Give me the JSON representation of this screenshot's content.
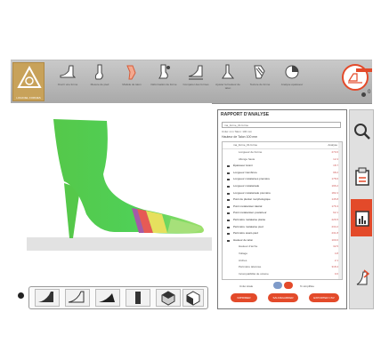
{
  "toolbar": {
    "logo_text": "LOGICIEL FORMES",
    "buttons": [
      {
        "label": "Ouvrir une forme",
        "icon": "shoe-icon"
      },
      {
        "label": "Mesure de pied",
        "icon": "foot-icon"
      },
      {
        "label": "Modèle de talon",
        "icon": "heel-icon"
      },
      {
        "label": "Déformation de forme",
        "icon": "deform-icon"
      },
      {
        "label": "Comparer des formes",
        "icon": "compare-icon"
      },
      {
        "label": "Ajuster la hauteur de talon",
        "icon": "heel-height-icon"
      },
      {
        "label": "Texture de forme",
        "icon": "texture-icon"
      },
      {
        "label": "Analyse épaisseur",
        "icon": "thickness-icon"
      }
    ],
    "status_small": "0"
  },
  "panel": {
    "title": "RAPPORT D'ANALYSE",
    "select_value": "ma_forme_01.forme",
    "subtitle": "Unité: mm   Talon: 100 mm",
    "note": "Hauteur de Talon 100 mm",
    "list_header": {
      "name": "ma_forme_01.forme",
      "value": "Analyse"
    },
    "rows": [
      {
        "name": "Longueur de Forme",
        "value": "270.6",
        "sub": true
      },
      {
        "name": "Allonge haute",
        "value": "12.4",
        "sub": true
      },
      {
        "name": "Épaisseur Avant",
        "value": "18.7",
        "sub": false
      },
      {
        "name": "Longueur Cambrure",
        "value": "98.2",
        "sub": false
      },
      {
        "name": "Longueur métatarses première",
        "value": "178.6",
        "sub": false
      },
      {
        "name": "Longueur métatarsale",
        "value": "196.2",
        "sub": false
      },
      {
        "name": "Longueur métatarsale première",
        "value": "182.4",
        "sub": false
      },
      {
        "name": "Point de plantar morphologique",
        "value": "145.8",
        "sub": false
      },
      {
        "name": "Point métatarsien latéral",
        "value": "176.3",
        "sub": false
      },
      {
        "name": "Point métatarsien postérieur",
        "value": "62.1",
        "sub": false
      },
      {
        "name": "Périmètre métatarse plante",
        "value": "226.5",
        "sub": false
      },
      {
        "name": "Périmètre métatarse pied",
        "value": "234.2",
        "sub": false
      },
      {
        "name": "Périmètre avant-pied",
        "value": "231.8",
        "sub": false
      },
      {
        "name": "Hauteur de talon",
        "value": "100.0",
        "sub": false
      },
      {
        "name": "Hauteur d'arche",
        "value": "32.5",
        "sub": true
      },
      {
        "name": "Voltage",
        "value": "4.8",
        "sub": true
      },
      {
        "name": "Arches",
        "value": "2.1",
        "sub": true
      },
      {
        "name": "Périmètre talonnée",
        "value": "318.4",
        "sub": true
      },
      {
        "name": "Incompatibilité de volume",
        "value": "0.6",
        "sub": true
      }
    ],
    "choice_left": "Unité totale",
    "choice_right": "% simplifiée",
    "actions": [
      "IMPRIMER",
      "SAUVEGARDER",
      "EXPORTER CSV"
    ]
  },
  "colors": {
    "accent": "#e34a2a",
    "shoe_green": "#4fcf55",
    "shoe_light": "#a8e07a",
    "toolbar_bg": "#b5b5b5"
  }
}
